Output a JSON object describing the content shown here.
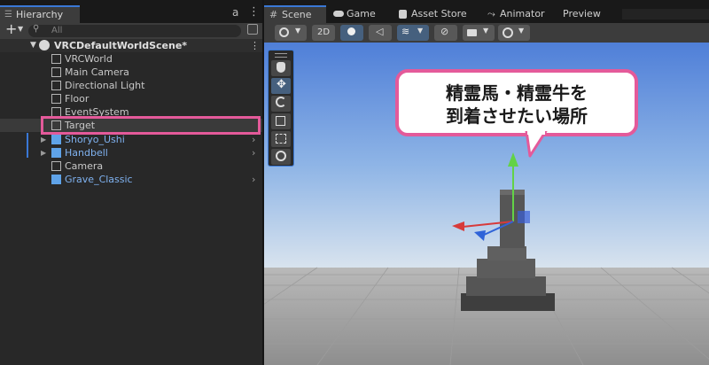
{
  "hierarchy": {
    "tab_label": "Hierarchy",
    "lock_glyph": "a",
    "menu_glyph": "⋮",
    "add_glyph": "+",
    "search_placeholder": "All",
    "scene_name": "VRCDefaultWorldScene*",
    "items": [
      {
        "label": "VRCWorld",
        "prefab": false,
        "expandable": false
      },
      {
        "label": "Main Camera",
        "prefab": false,
        "expandable": false
      },
      {
        "label": "Directional Light",
        "prefab": false,
        "expandable": false
      },
      {
        "label": "Floor",
        "prefab": false,
        "expandable": false
      },
      {
        "label": "EventSystem",
        "prefab": false,
        "expandable": false
      },
      {
        "label": "Target",
        "prefab": false,
        "expandable": false,
        "highlighted": true
      },
      {
        "label": "Shoryo_Ushi",
        "prefab": true,
        "expandable": true
      },
      {
        "label": "Handbell",
        "prefab": true,
        "expandable": true
      },
      {
        "label": "Camera",
        "prefab": false,
        "expandable": false
      },
      {
        "label": "Grave_Classic",
        "prefab": true,
        "expandable": false
      }
    ]
  },
  "scene": {
    "tabs": [
      {
        "label": "Scene",
        "icon": "hash-icon",
        "active": true
      },
      {
        "label": "Game",
        "icon": "gamepad-icon",
        "active": false
      },
      {
        "label": "Asset Store",
        "icon": "store-icon",
        "active": false
      },
      {
        "label": "Animator",
        "icon": "animator-icon",
        "active": false
      },
      {
        "label": "Preview",
        "icon": "",
        "active": false
      }
    ],
    "toolbar": {
      "mode_2d_label": "2D"
    },
    "callout_text_line1": "精霊馬・精霊牛を",
    "callout_text_line2": "到着させたい場所"
  },
  "colors": {
    "accent": "#3a78d6",
    "highlight": "#e45a9a",
    "prefab_text": "#7fb2f0",
    "sky_top": "#4f7fd8",
    "ground": "#a9a9a9"
  }
}
